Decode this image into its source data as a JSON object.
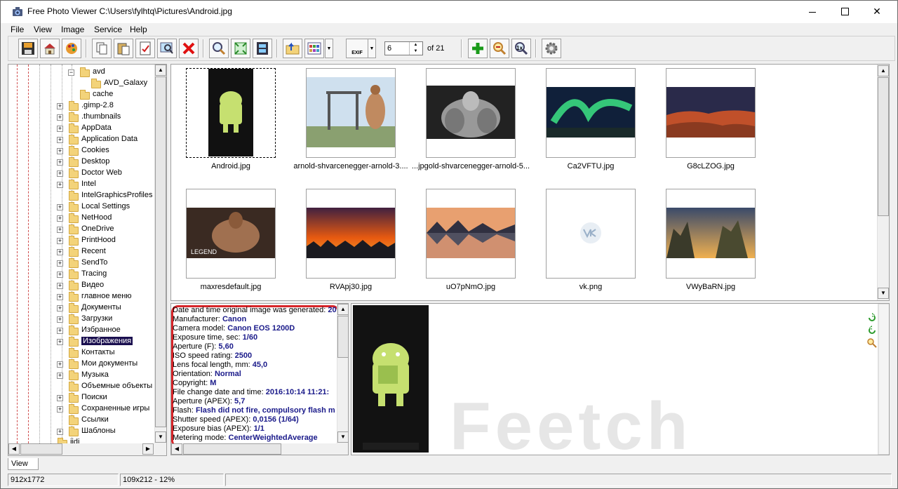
{
  "window": {
    "title": "Free Photo Viewer C:\\Users\\fylhtq\\Pictures\\Android.jpg",
    "close_glyph": "✕"
  },
  "menu": [
    "File",
    "View",
    "Image",
    "Service",
    "Help"
  ],
  "toolbar": {
    "page_value": "6",
    "page_of": "of 21",
    "exif_label": "EXIF",
    "zoom_1x_label": "1x"
  },
  "tree": {
    "items": [
      {
        "label": "avd",
        "level": 2,
        "expander": "−"
      },
      {
        "label": "AVD_Galaxy",
        "level": 3,
        "expander": ""
      },
      {
        "label": "cache",
        "level": 2,
        "expander": ""
      },
      {
        "label": ".gimp-2.8",
        "level": 1,
        "expander": "+"
      },
      {
        "label": ".thumbnails",
        "level": 1,
        "expander": "+"
      },
      {
        "label": "AppData",
        "level": 1,
        "expander": "+"
      },
      {
        "label": "Application Data",
        "level": 1,
        "expander": "+"
      },
      {
        "label": "Cookies",
        "level": 1,
        "expander": "+"
      },
      {
        "label": "Desktop",
        "level": 1,
        "expander": "+"
      },
      {
        "label": "Doctor Web",
        "level": 1,
        "expander": "+"
      },
      {
        "label": "Intel",
        "level": 1,
        "expander": "+"
      },
      {
        "label": "IntelGraphicsProfiles",
        "level": 1,
        "expander": ""
      },
      {
        "label": "Local Settings",
        "level": 1,
        "expander": "+"
      },
      {
        "label": "NetHood",
        "level": 1,
        "expander": "+"
      },
      {
        "label": "OneDrive",
        "level": 1,
        "expander": "+"
      },
      {
        "label": "PrintHood",
        "level": 1,
        "expander": "+"
      },
      {
        "label": "Recent",
        "level": 1,
        "expander": "+"
      },
      {
        "label": "SendTo",
        "level": 1,
        "expander": "+"
      },
      {
        "label": "Tracing",
        "level": 1,
        "expander": "+"
      },
      {
        "label": "Видео",
        "level": 1,
        "expander": "+"
      },
      {
        "label": "главное меню",
        "level": 1,
        "expander": "+"
      },
      {
        "label": "Документы",
        "level": 1,
        "expander": "+"
      },
      {
        "label": "Загрузки",
        "level": 1,
        "expander": "+"
      },
      {
        "label": "Избранное",
        "level": 1,
        "expander": "+"
      },
      {
        "label": "Изображения",
        "level": 1,
        "expander": "+",
        "selected": true
      },
      {
        "label": "Контакты",
        "level": 1,
        "expander": ""
      },
      {
        "label": "Мои документы",
        "level": 1,
        "expander": "+"
      },
      {
        "label": "Музыка",
        "level": 1,
        "expander": "+"
      },
      {
        "label": "Объемные объекты",
        "level": 1,
        "expander": ""
      },
      {
        "label": "Поиски",
        "level": 1,
        "expander": "+"
      },
      {
        "label": "Сохраненные игры",
        "level": 1,
        "expander": "+"
      },
      {
        "label": "Ссылки",
        "level": 1,
        "expander": ""
      },
      {
        "label": "Шаблоны",
        "level": 1,
        "expander": "+"
      },
      {
        "label": "jidi",
        "level": 0,
        "expander": ""
      }
    ]
  },
  "gallery": {
    "images": [
      {
        "name": "Android.jpg",
        "kind": "phone",
        "selected": true
      },
      {
        "name": "arnold-shvarcenegger-arnold-3....",
        "kind": "gym"
      },
      {
        "name": "...jpgold-shvarcenegger-arnold-5...",
        "kind": "bw"
      },
      {
        "name": "Ca2VFTU.jpg",
        "kind": "aurora"
      },
      {
        "name": "G8cLZOG.jpg",
        "kind": "canyon"
      },
      {
        "name": "maxresdefault.jpg",
        "kind": "legend"
      },
      {
        "name": "RVApj30.jpg",
        "kind": "sunset"
      },
      {
        "name": "uO7pNmO.jpg",
        "kind": "lake"
      },
      {
        "name": "vk.png",
        "kind": "vk"
      },
      {
        "name": "VWyBaRN.jpg",
        "kind": "rocks"
      }
    ],
    "legend_text": "LEGEND"
  },
  "exif": [
    {
      "label": "Date and time original image was generated:",
      "value": "20"
    },
    {
      "label": "Manufacturer:",
      "value": "Canon"
    },
    {
      "label": "Camera model:",
      "value": "Canon EOS 1200D"
    },
    {
      "label": "Exposure time, sec:",
      "value": "1/60"
    },
    {
      "label": "Aperture (F):",
      "value": "5,60"
    },
    {
      "label": "ISO speed rating:",
      "value": "2500"
    },
    {
      "label": "Lens focal length, mm:",
      "value": "45,0"
    },
    {
      "label": "Orientation:",
      "value": "Normal"
    },
    {
      "label": "Copyright:",
      "value": "M"
    },
    {
      "label": "File change date and time:",
      "value": "2016:10:14 11:21:"
    },
    {
      "label": "Aperture (APEX):",
      "value": "5,7"
    },
    {
      "label": "Flash:",
      "value": "Flash did not fire, compulsory flash m"
    },
    {
      "label": "Shutter speed (APEX):",
      "value": "0,0156 (1/64)"
    },
    {
      "label": "Exposure bias (APEX):",
      "value": "1/1"
    },
    {
      "label": "Metering mode:",
      "value": "CenterWeightedAverage"
    }
  ],
  "preview": {
    "watermark": "Feetch"
  },
  "tabs": [
    "View"
  ],
  "status": {
    "dimensions": "912x1772",
    "zoom": "109x212 - 12%",
    "extra": ""
  },
  "colors": {
    "selection": "#1a0f4f",
    "exif_highlight": "#d8262a",
    "exif_value": "#1a1a8a"
  }
}
